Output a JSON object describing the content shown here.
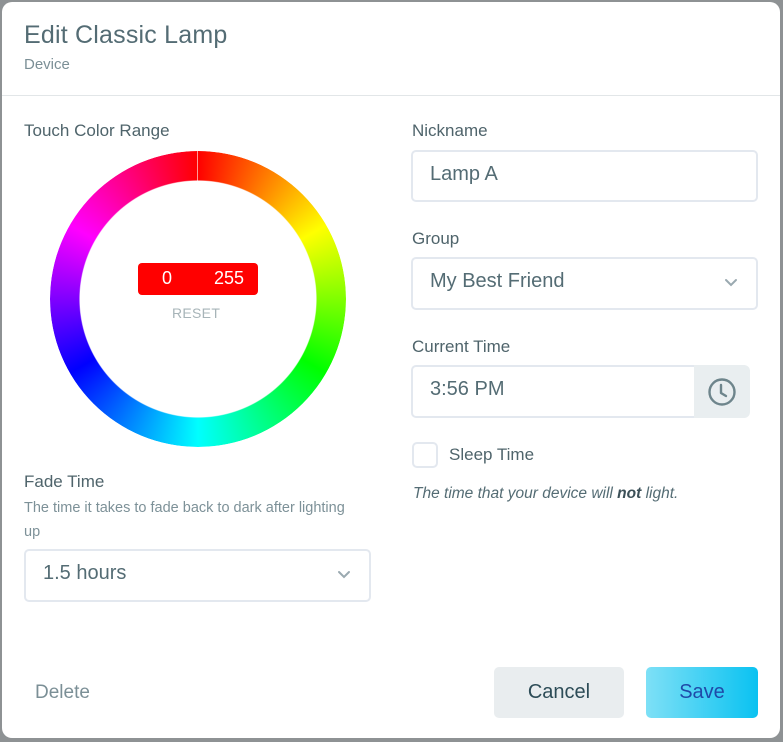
{
  "dialog": {
    "title": "Edit Classic Lamp",
    "subtitle": "Device"
  },
  "touch_color": {
    "label": "Touch Color Range",
    "min_value": "0",
    "max_value": "255",
    "range_color": "#ff0000",
    "reset_label": "RESET"
  },
  "fade_time": {
    "label": "Fade Time",
    "help": "The time it takes to fade back to dark after lighting up",
    "selected": "1.5 hours"
  },
  "nickname": {
    "label": "Nickname",
    "value": "Lamp A"
  },
  "group": {
    "label": "Group",
    "selected": "My Best Friend"
  },
  "current_time": {
    "label": "Current Time",
    "value": "3:56 PM",
    "icon": "clock-icon"
  },
  "sleep_time": {
    "label": "Sleep Time",
    "checked": false,
    "note_before": "The time that your device will ",
    "note_bold": "not",
    "note_after": " light."
  },
  "footer": {
    "delete_label": "Delete",
    "cancel_label": "Cancel",
    "save_label": "Save"
  },
  "colors": {
    "accent_gradient_start": "#7ee0f6",
    "accent_gradient_end": "#0ac2f1",
    "text_primary": "#546c74"
  }
}
